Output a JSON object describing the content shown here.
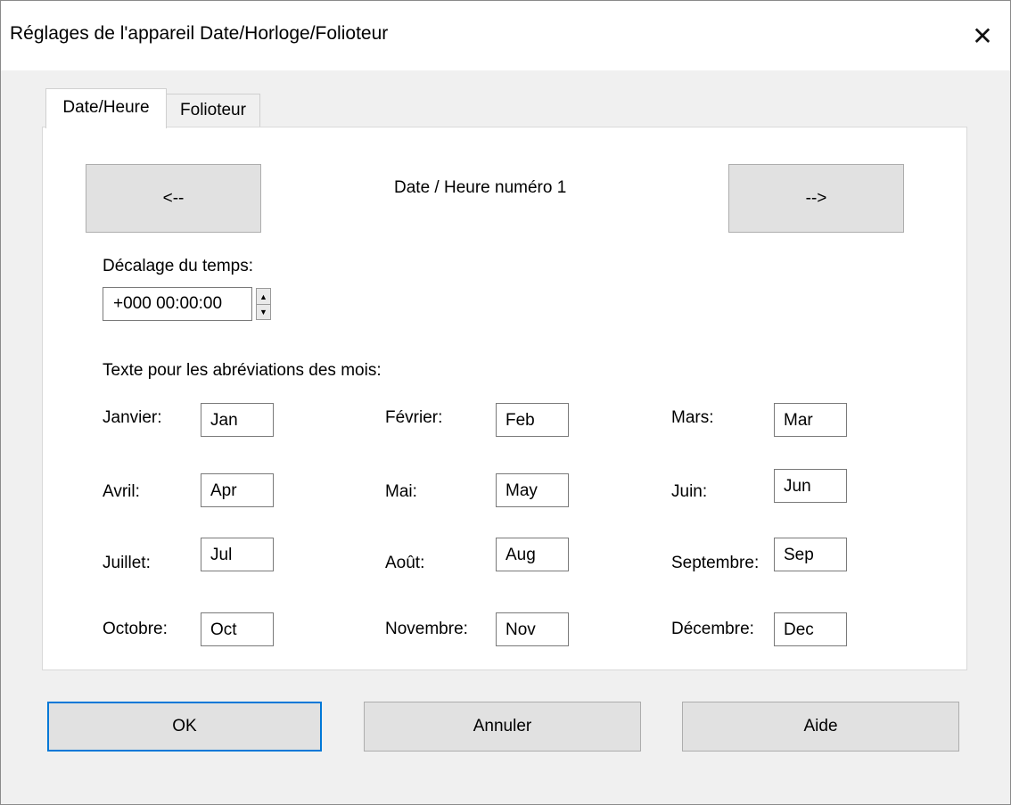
{
  "window": {
    "title": "Réglages de l'appareil Date/Horloge/Folioteur",
    "close_glyph": "✕"
  },
  "tabs": [
    {
      "label": "Date/Heure",
      "active": true
    },
    {
      "label": "Folioteur",
      "active": false
    }
  ],
  "nav": {
    "prev_label": "<--",
    "next_label": "-->",
    "caption": "Date / Heure numéro 1"
  },
  "offset": {
    "label": "Décalage du temps:",
    "value": "+000 00:00:00"
  },
  "months": {
    "heading": "Texte pour les abréviations des mois:",
    "items": [
      {
        "label": "Janvier:",
        "value": "Jan"
      },
      {
        "label": "Février:",
        "value": "Feb"
      },
      {
        "label": "Mars:",
        "value": "Mar"
      },
      {
        "label": "Avril:",
        "value": "Apr"
      },
      {
        "label": "Mai:",
        "value": "May"
      },
      {
        "label": "Juin:",
        "value": "Jun"
      },
      {
        "label": "Juillet:",
        "value": "Jul"
      },
      {
        "label": "Août:",
        "value": "Aug"
      },
      {
        "label": "Septembre:",
        "value": "Sep"
      },
      {
        "label": "Octobre:",
        "value": "Oct"
      },
      {
        "label": "Novembre:",
        "value": "Nov"
      },
      {
        "label": "Décembre:",
        "value": "Dec"
      }
    ]
  },
  "footer": {
    "ok_label": "OK",
    "cancel_label": "Annuler",
    "help_label": "Aide"
  },
  "colors": {
    "focus_border": "#0078d7",
    "button_face": "#e1e1e1",
    "dialog_bg": "#f0f0f0"
  }
}
